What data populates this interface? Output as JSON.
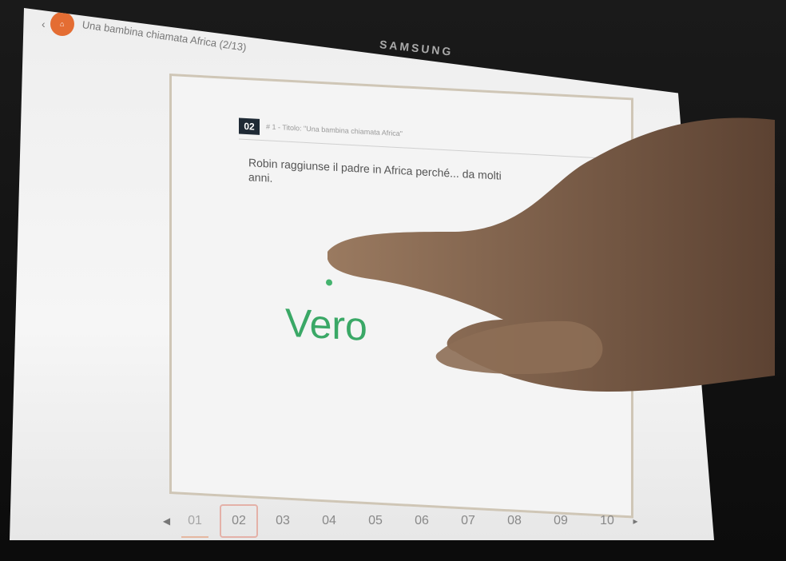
{
  "device": {
    "brand": "SAMSUNG"
  },
  "appbar": {
    "back_icon": "chevron-left-icon",
    "logo_icon": "app-logo",
    "title": "Una bambina chiamata Africa (2/13)"
  },
  "question": {
    "number": "02",
    "source": "# 1 - Titolo: \"Una bambina chiamata Africa\"",
    "text": "Robin raggiunse il padre in Africa perché... da molti anni.",
    "answer": "Vero"
  },
  "pager": {
    "prev_icon": "chevron-left-icon",
    "next_icon": "chevron-right-icon",
    "pages": [
      "01",
      "02",
      "03",
      "04",
      "05",
      "06",
      "07",
      "08",
      "09",
      "10"
    ],
    "active": "01",
    "selected": "02"
  }
}
